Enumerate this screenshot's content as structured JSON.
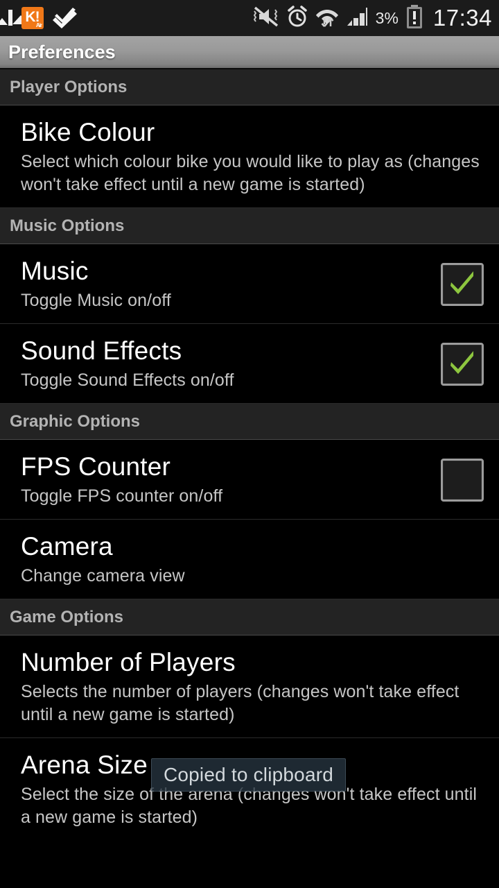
{
  "status_bar": {
    "notification_icons": [
      {
        "name": "photo-icon",
        "label": "photo"
      },
      {
        "name": "kahoot-app-icon",
        "label": "K!",
        "sub_label": "Air",
        "color": "#f07818"
      },
      {
        "name": "double-check-icon",
        "label": "double check"
      }
    ],
    "system_icons": [
      {
        "name": "vibrate-mute-icon",
        "label": "mute"
      },
      {
        "name": "alarm-clock-icon",
        "label": "alarm"
      },
      {
        "name": "wifi-data-icon",
        "label": "wifi"
      },
      {
        "name": "signal-bars-icon",
        "label": "signal"
      }
    ],
    "battery_percent": "3%",
    "battery_state": "low",
    "clock": "17:34"
  },
  "title_bar": {
    "title": "Preferences"
  },
  "sections": [
    {
      "header": "Player Options",
      "items": [
        {
          "title": "Bike Colour",
          "summary": "Select which colour bike you would like to play as (changes won't take effect until a new game is started)",
          "widget": "none"
        }
      ]
    },
    {
      "header": "Music Options",
      "items": [
        {
          "title": "Music",
          "summary": "Toggle Music on/off",
          "widget": "checkbox",
          "checked": true
        },
        {
          "title": "Sound Effects",
          "summary": "Toggle Sound Effects on/off",
          "widget": "checkbox",
          "checked": true
        }
      ]
    },
    {
      "header": "Graphic Options",
      "items": [
        {
          "title": "FPS Counter",
          "summary": "Toggle FPS counter on/off",
          "widget": "checkbox",
          "checked": false
        },
        {
          "title": "Camera",
          "summary": "Change camera view",
          "widget": "none"
        }
      ]
    },
    {
      "header": "Game Options",
      "items": [
        {
          "title": "Number of Players",
          "summary": "Selects the number of players (changes won't take effect until a new game is started)",
          "widget": "none"
        },
        {
          "title": "Arena Size",
          "summary": "Select the size of the arena (changes won't take effect until a new game is started)",
          "widget": "none"
        }
      ]
    }
  ],
  "toast": {
    "message": "Copied to clipboard"
  },
  "colors": {
    "background": "#000000",
    "section_header_bg": "#232323",
    "section_header_text": "#b3b3b3",
    "title_text": "#ffffff",
    "summary_text": "#c6c6c6",
    "checkbox_tick": "#8dc63f",
    "titlebar_gray": "#9a9a9a",
    "accent_orange": "#f07818"
  }
}
